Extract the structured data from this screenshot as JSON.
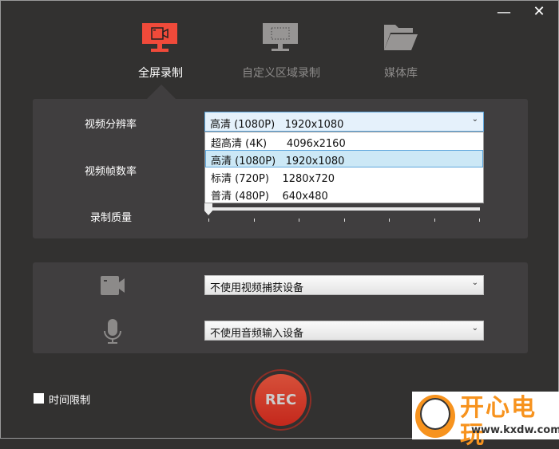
{
  "window": {
    "minimize_icon": "minimize-icon",
    "close_icon": "close-icon"
  },
  "tabs": [
    {
      "label": "全屏录制",
      "icon": "monitor-camera-icon",
      "active": true
    },
    {
      "label": "自定义区域录制",
      "icon": "monitor-region-icon",
      "active": false
    },
    {
      "label": "媒体库",
      "icon": "folder-icon",
      "active": false
    }
  ],
  "video": {
    "resolution_label": "视频分辨率",
    "resolution_value": "高清 (1080P)   1920x1080",
    "resolution_options": [
      "超高清 (4K)      4096x2160",
      "高清 (1080P)   1920x1080",
      "标清 (720P)    1280x720",
      "普清 (480P)    640x480"
    ],
    "selected_index": 1,
    "framerate_label": "视频帧数率",
    "quality_label": "录制质量",
    "quality_value": 0
  },
  "devices": {
    "camera_value": "不使用视频捕获设备",
    "audio_value": "不使用音频输入设备"
  },
  "footer": {
    "time_limit_label": "时间限制",
    "time_limit_checked": false,
    "rec_label": "REC"
  },
  "watermark": {
    "text": "开心电玩",
    "url": "www.kxdw.com"
  },
  "colors": {
    "accent": "#f04a3a",
    "bg": "#323130",
    "panel": "#403e3f"
  }
}
